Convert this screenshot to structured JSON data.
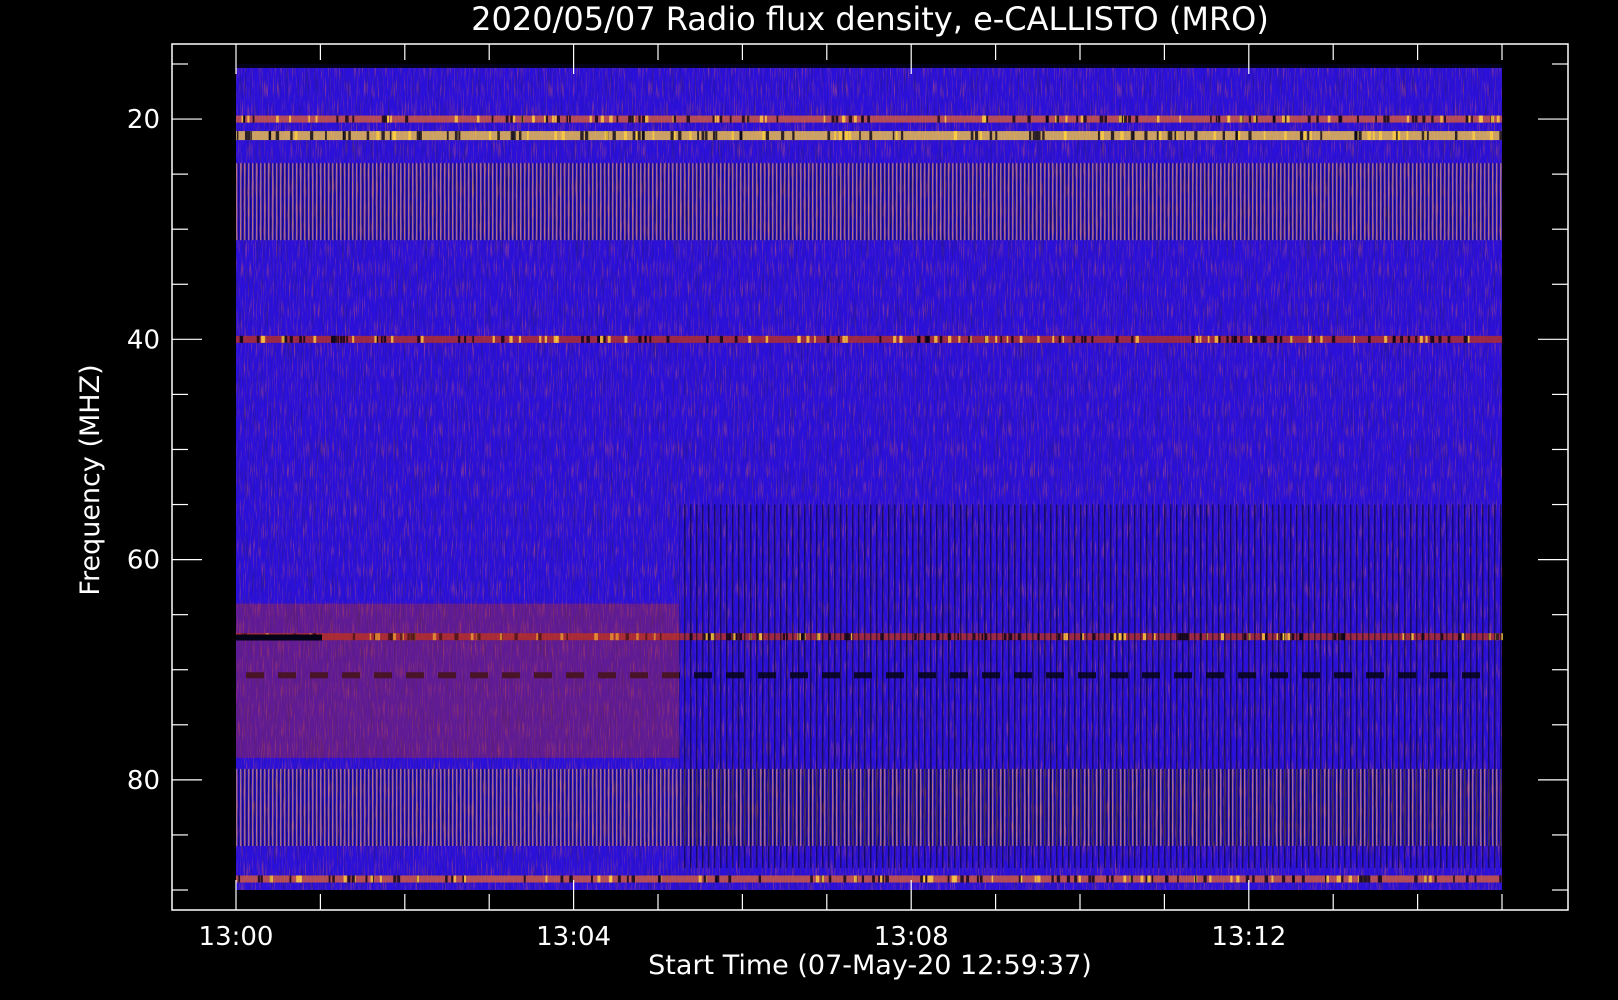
{
  "chart_data": {
    "type": "heatmap",
    "title": "2020/05/07  Radio flux density, e-CALLISTO (MRO)",
    "xlabel": "Start Time (07-May-20 12:59:37)",
    "ylabel": "Frequency (MHZ)",
    "x_range": [
      "13:00",
      "13:15"
    ],
    "y_range_mhz": [
      15,
      90
    ],
    "x_ticks": [
      "13:00",
      "13:04",
      "13:08",
      "13:12"
    ],
    "y_ticks": [
      20,
      40,
      60,
      80
    ],
    "y_inverted": true,
    "colormap": "blue-red-yellow",
    "bands_mhz": [
      {
        "freq": 20,
        "level": "high"
      },
      {
        "freq": 21.5,
        "level": "very-high"
      },
      {
        "freq": 28,
        "level": "high"
      },
      {
        "freq": 40,
        "level": "medium"
      },
      {
        "freq": 67,
        "level": "medium"
      },
      {
        "freq": 70.5,
        "level": "low"
      },
      {
        "freq": 83,
        "level": "high"
      },
      {
        "freq": 89,
        "level": "high"
      }
    ]
  },
  "colors": {
    "background": "#000000",
    "base": "#2a10d8",
    "low": "#0a0630",
    "mid": "#c0301a",
    "high": "#ffd040"
  }
}
